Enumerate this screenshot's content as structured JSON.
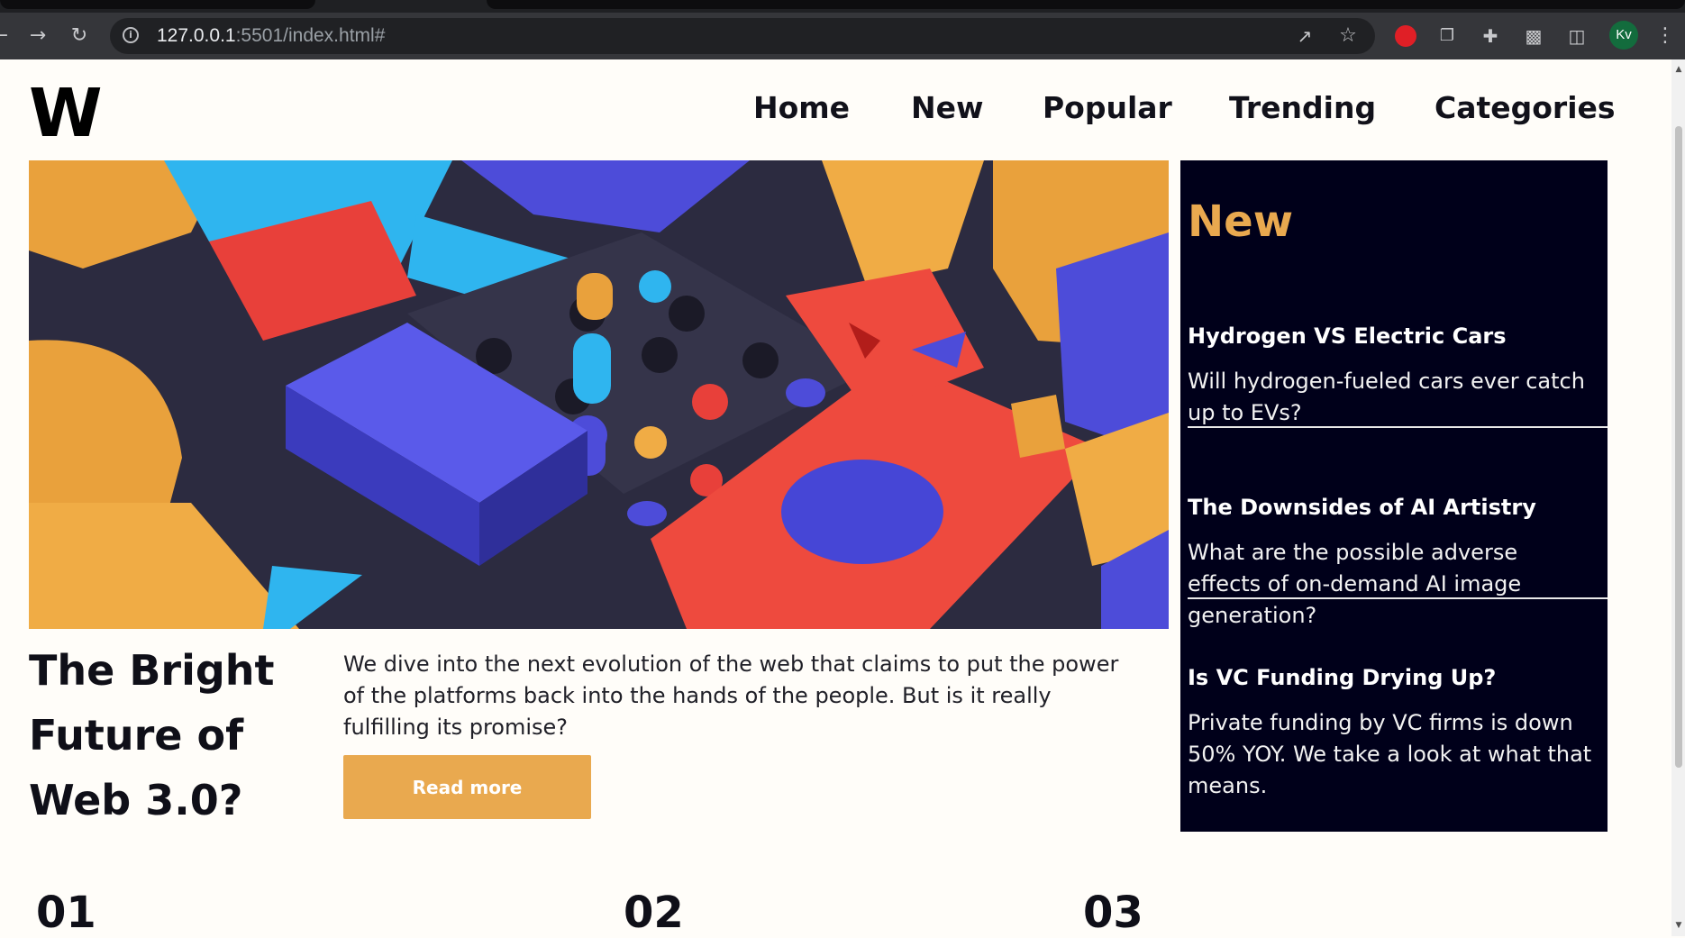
{
  "browser": {
    "url_host": "127.0.0.1",
    "url_rest": ":5501/index.html#",
    "profile_initials": "Kv"
  },
  "site": {
    "logo": "W",
    "nav": [
      {
        "label": "Home"
      },
      {
        "label": "New"
      },
      {
        "label": "Popular"
      },
      {
        "label": "Trending"
      },
      {
        "label": "Categories"
      }
    ]
  },
  "hero": {
    "title": "The Bright Future of Web 3.0?",
    "description": "We dive into the next evolution of the web that claims to put the power of the platforms back into the hands of the people. But is it really fulfilling its promise?",
    "button_label": "Read more"
  },
  "sidebar": {
    "title": "New",
    "stories": [
      {
        "headline": "Hydrogen VS Electric Cars",
        "summary": "Will hydrogen-fueled cars ever catch up to EVs?"
      },
      {
        "headline": "The Downsides of AI Artistry",
        "summary": "What are the possible adverse effects of on-demand AI image generation?"
      },
      {
        "headline": "Is VC Funding Drying Up?",
        "summary": "Private funding by VC firms is down 50% YOY. We take a look at what that means."
      }
    ]
  },
  "numbers": [
    "01",
    "02",
    "03"
  ],
  "colors": {
    "accent": "#e9a94f",
    "sidebar_bg": "#00001a",
    "page_bg": "#fffdf9"
  }
}
